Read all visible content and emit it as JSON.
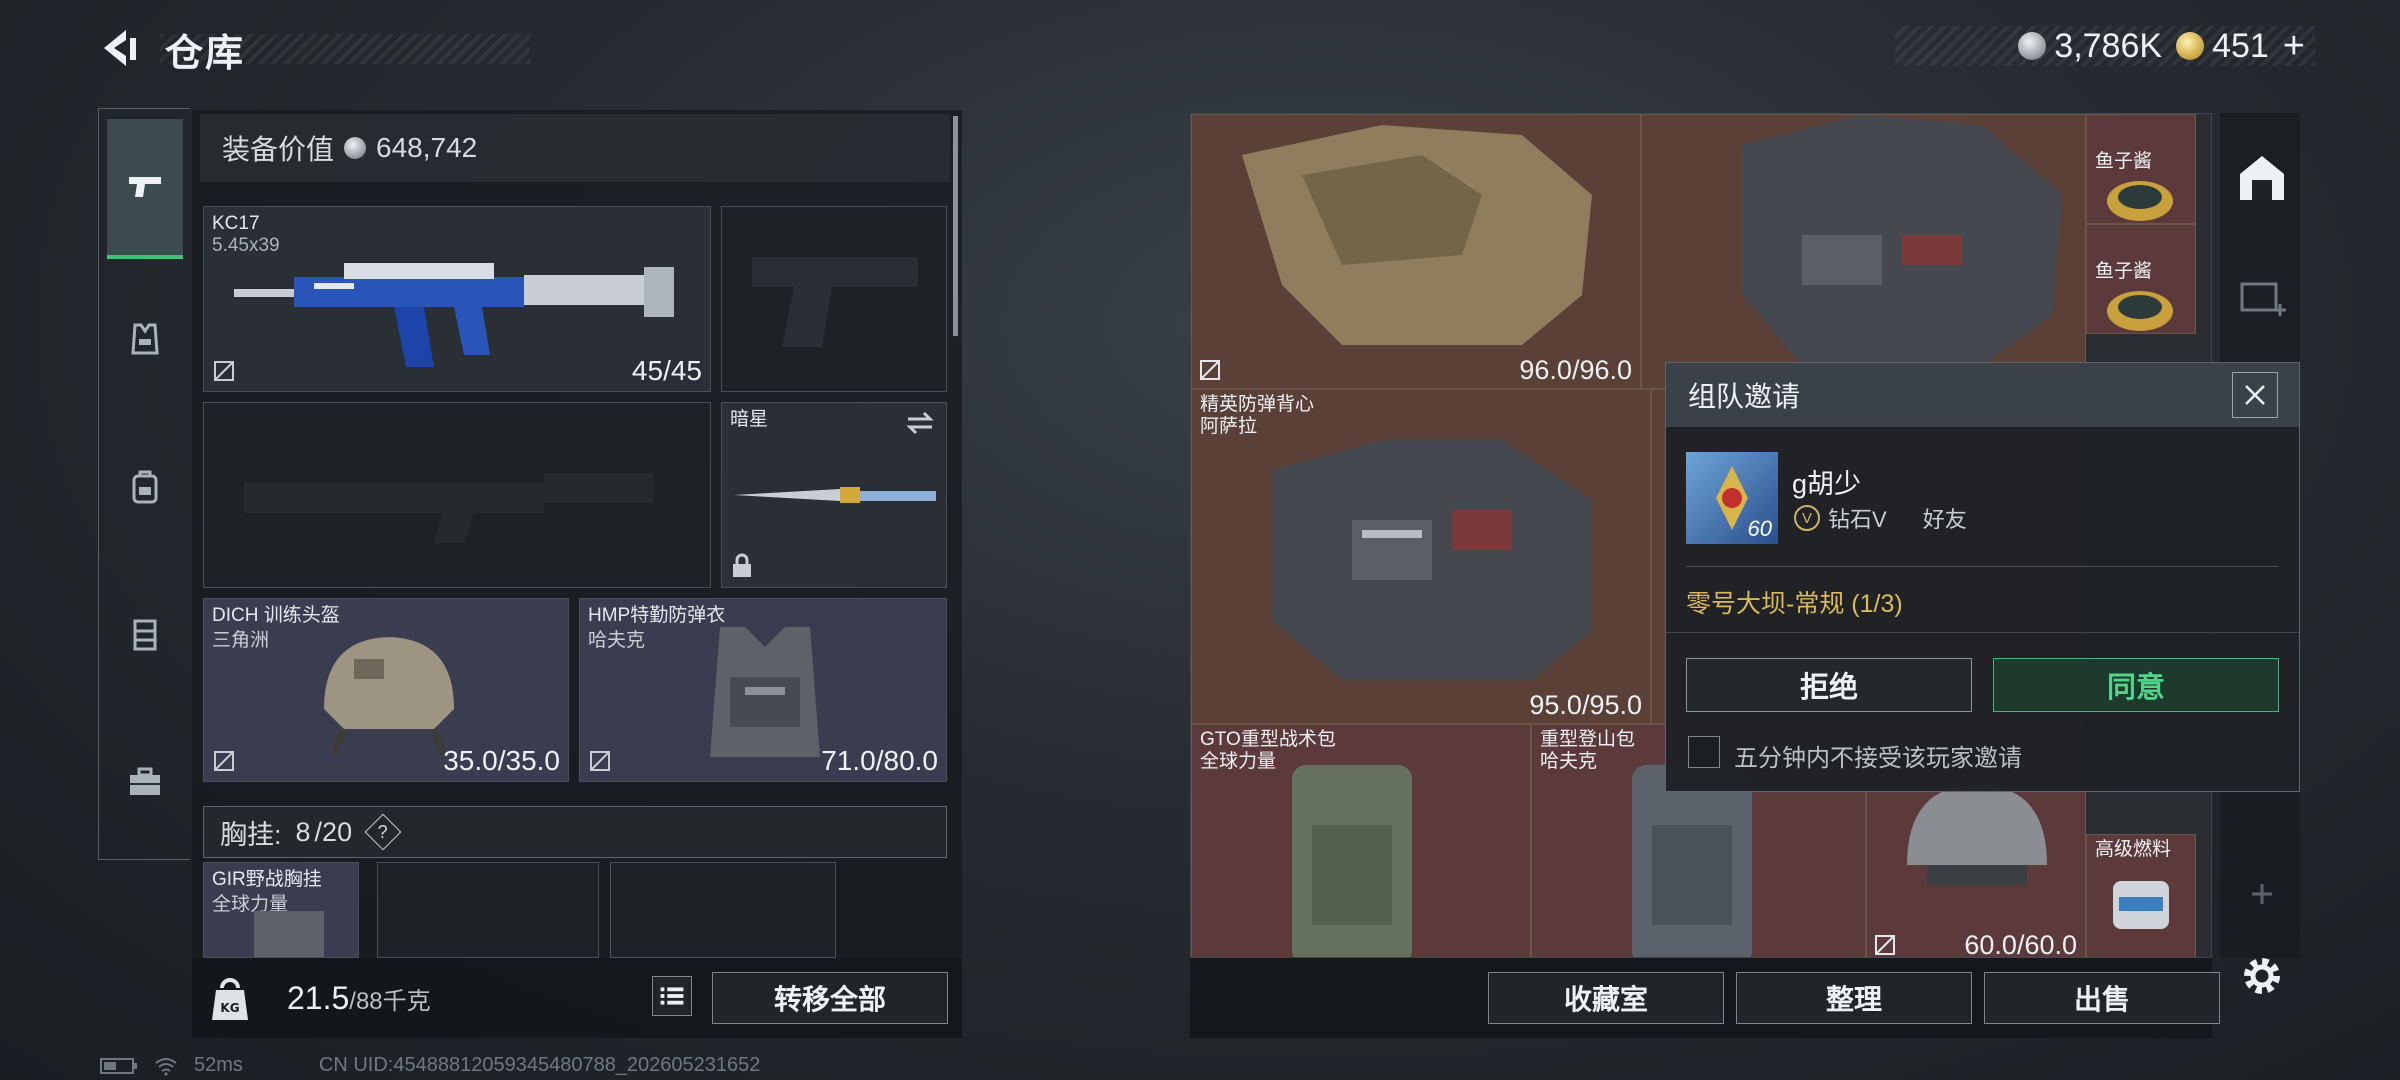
{
  "header": {
    "title": "仓库",
    "currency": [
      {
        "icon": "silver-coin-icon",
        "value": "3,786K"
      },
      {
        "icon": "gold-coin-icon",
        "value": "451"
      }
    ],
    "plus": "+"
  },
  "tabs": [
    {
      "icon": "pistol-icon",
      "active": true
    },
    {
      "icon": "vest-icon",
      "active": false
    },
    {
      "icon": "backpack-icon",
      "active": false
    },
    {
      "icon": "chest-rig-icon",
      "active": false
    },
    {
      "icon": "briefcase-icon",
      "active": false
    }
  ],
  "equipment": {
    "value_label": "装备价值",
    "value": "648,742",
    "primary": {
      "name": "KC17",
      "ammo": "5.45x39",
      "durability": "45/45"
    },
    "melee": {
      "name": "暗星"
    },
    "helmet": {
      "name": "DICH 训练头盔",
      "brand": "三角洲",
      "durability": "35.0/35.0"
    },
    "armor": {
      "name": "HMP特勤防弹衣",
      "brand": "哈夫克",
      "durability": "71.0/80.0"
    },
    "chest_rig": {
      "label": "胸挂:",
      "used": "8",
      "capacity": "/20",
      "help": "?"
    },
    "rig_item": {
      "name": "GIR野战胸挂",
      "brand": "全球力量"
    },
    "weight": {
      "current": "21.5",
      "max": "/88千克"
    },
    "transfer_all": "转移全部"
  },
  "storage": {
    "items": [
      {
        "name": "",
        "value": "96.0/96.0"
      },
      {
        "name": "精英防弹背心",
        "brand": "阿萨拉",
        "value": "95.0/95.0"
      },
      {
        "name": "GTO重型战术包",
        "brand": "全球力量"
      },
      {
        "name": "重型登山包",
        "brand": "哈夫克"
      },
      {
        "name": "",
        "value": "60.0/60.0"
      },
      {
        "name": "鱼子酱"
      },
      {
        "name": "鱼子酱"
      },
      {
        "name": "高级燃料"
      }
    ],
    "buttons": {
      "collection": "收藏室",
      "organize": "整理",
      "sell": "出售"
    }
  },
  "invite": {
    "title": "组队邀请",
    "player": "g胡少",
    "level": "60",
    "rank": "钻石V",
    "relation": "好友",
    "mode": "零号大坝-常规 (1/3)",
    "reject": "拒绝",
    "accept": "同意",
    "mute_label": "五分钟内不接受该玩家邀请"
  },
  "status": {
    "ping": "52ms",
    "uid": "CN UID:454888120593454807​88_202605231652"
  }
}
